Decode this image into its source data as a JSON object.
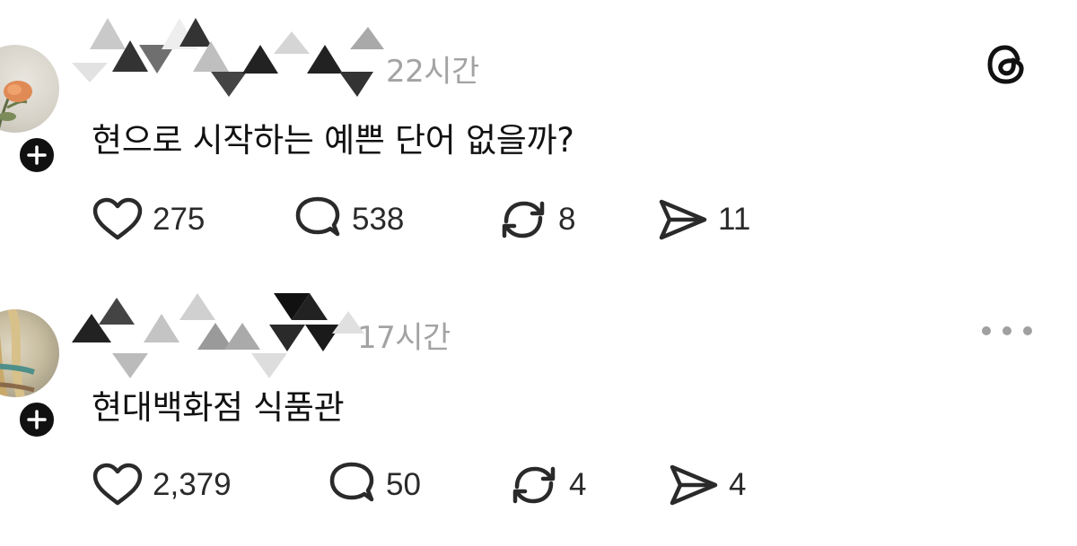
{
  "app": {
    "logo_icon": "threads-logo-icon"
  },
  "posts": [
    {
      "time": "22시간",
      "text": "현으로 시작하는 예쁜 단어 없을까?",
      "likes": "275",
      "replies": "538",
      "reposts": "8",
      "shares": "11"
    },
    {
      "time": "17시간",
      "text": "현대백화점 식품관",
      "likes": "2,379",
      "replies": "50",
      "reposts": "4",
      "shares": "4"
    }
  ],
  "icons": {
    "like": "heart-icon",
    "reply": "comment-icon",
    "repost": "repost-icon",
    "share": "send-icon",
    "follow": "plus-icon",
    "more": "more-dots-icon"
  },
  "colors": {
    "text": "#111111",
    "muted": "#a3a3a3",
    "icon": "#2a2a2a"
  }
}
